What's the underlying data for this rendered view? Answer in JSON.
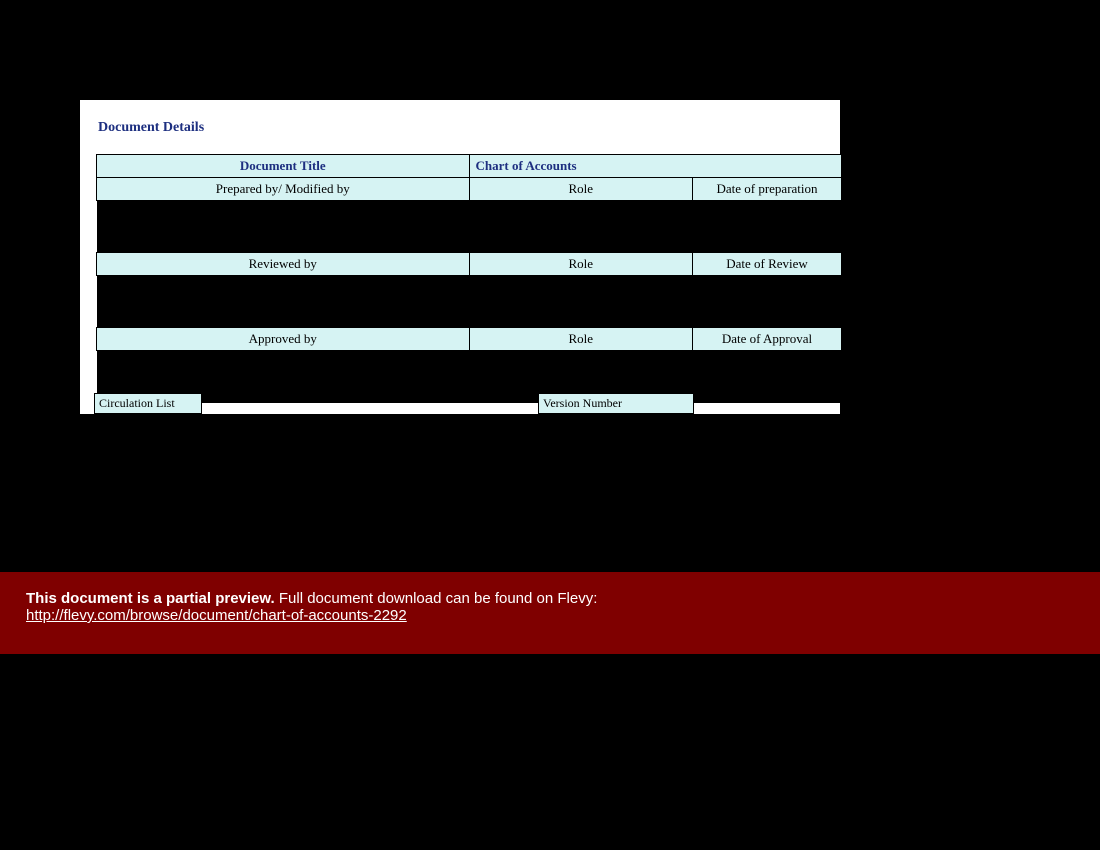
{
  "section_title": "Document Details",
  "table": {
    "title_label": "Document Title",
    "title_value": "Chart of Accounts",
    "rows": [
      {
        "c1": "Prepared by/ Modified by",
        "c2": "Role",
        "c3": "Date of preparation"
      },
      {
        "c1": "Reviewed by",
        "c2": "Role",
        "c3": "Date of Review"
      },
      {
        "c1": "Approved by",
        "c2": "Role",
        "c3": "Date of Approval"
      }
    ]
  },
  "circulation_label": "Circulation List",
  "version_label": "Version Number",
  "preview": {
    "strong": "This document is a partial preview.",
    "rest": "  Full document download can be found on Flevy:",
    "link": "http://flevy.com/browse/document/chart-of-accounts-2292"
  }
}
